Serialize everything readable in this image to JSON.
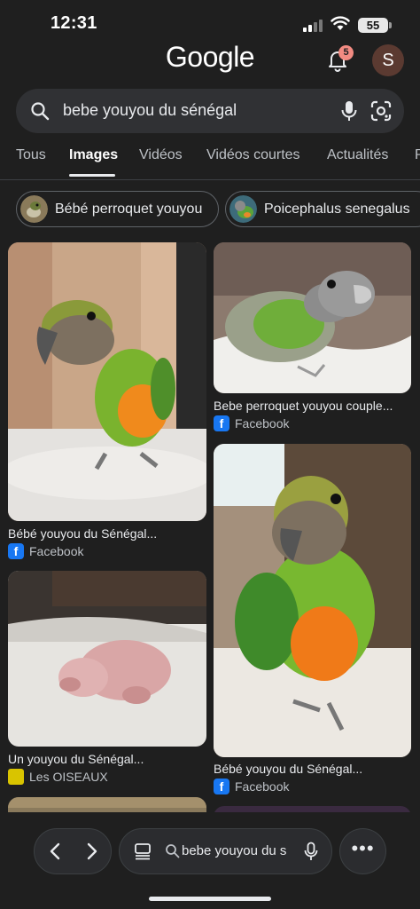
{
  "status_bar": {
    "time": "12:31",
    "battery": "55"
  },
  "header": {
    "logo": "Google",
    "notification_count": "5",
    "avatar_initial": "S"
  },
  "search": {
    "query": "bebe youyou du sénégal",
    "icons": [
      "search-icon",
      "mic-icon",
      "lens-icon"
    ]
  },
  "tabs": [
    "Tous",
    "Images",
    "Vidéos",
    "Vidéos courtes",
    "Actualités",
    "P"
  ],
  "active_tab": "Images",
  "chips": [
    {
      "label": "Bébé perroquet youyou"
    },
    {
      "label": "Poicephalus senegalus"
    }
  ],
  "results": [
    {
      "title": "Bébé youyou du Sénégal...",
      "source": "Facebook",
      "source_icon": "facebook-icon"
    },
    {
      "title": "Bebe perroquet youyou couple...",
      "source": "Facebook",
      "source_icon": "facebook-icon"
    },
    {
      "title": "Un youyou du Sénégal...",
      "source": "Les OISEAUX",
      "source_icon": "oiseaux-icon"
    },
    {
      "title": "Bébé youyou du Sénégal...",
      "source": "Facebook",
      "source_icon": "facebook-icon"
    }
  ],
  "bottom_bar": {
    "url_text": "bebe youyou du s",
    "more_label": "•••"
  },
  "colors": {
    "background": "#1f1f1f",
    "search_bg": "#303134",
    "text": "#e8eaed",
    "facebook": "#1877f2",
    "badge": "#f28b82"
  }
}
